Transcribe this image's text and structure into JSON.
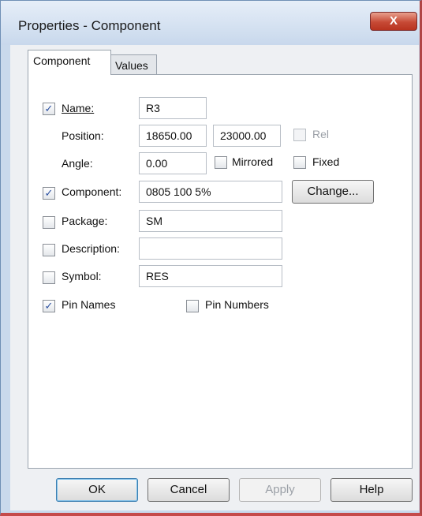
{
  "window": {
    "title": "Properties - Component",
    "close_label": "X"
  },
  "tabs": [
    {
      "label": "Component",
      "active": true
    },
    {
      "label": "Values",
      "active": false
    }
  ],
  "fields": {
    "name": {
      "label": "Name:",
      "checked": true,
      "value": "R3"
    },
    "position": {
      "label": "Position:",
      "x": "18650.00",
      "y": "23000.00"
    },
    "rel": {
      "label": "Rel",
      "checked": false,
      "disabled": true
    },
    "angle": {
      "label": "Angle:",
      "value": "0.00"
    },
    "mirrored": {
      "label": "Mirrored",
      "checked": false
    },
    "fixed": {
      "label": "Fixed",
      "checked": false
    },
    "component": {
      "label": "Component:",
      "checked": true,
      "value": "0805 100 5%"
    },
    "change_button": "Change...",
    "package": {
      "label": "Package:",
      "checked": false,
      "value": "SM"
    },
    "description": {
      "label": "Description:",
      "checked": false,
      "value": ""
    },
    "symbol": {
      "label": "Symbol:",
      "checked": false,
      "value": "RES"
    },
    "pin_names": {
      "label": "Pin Names",
      "checked": true
    },
    "pin_numbers": {
      "label": "Pin Numbers",
      "checked": false
    }
  },
  "buttons": {
    "ok": "OK",
    "cancel": "Cancel",
    "apply": "Apply",
    "help": "Help"
  }
}
